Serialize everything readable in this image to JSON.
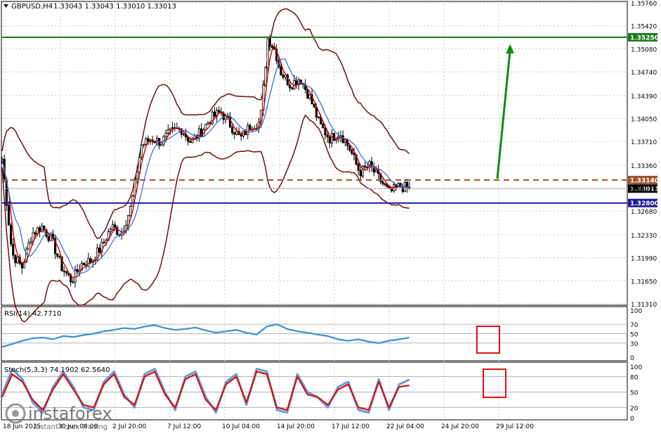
{
  "main_header": {
    "symbol_tf": "GBPUSD,H4",
    "ohlc": "1.33043 1.33043 1.33010 1.33013"
  },
  "rsi_header": "RSI(14) 42.7710",
  "stoch_header": "Stoch(5,3,3) 74.1902 62.5640",
  "logo": {
    "name": "instaforex",
    "tagline": "Instant Forex Trading"
  },
  "colors": {
    "background": "#ffffff",
    "grid": "#c8c8c8",
    "candle": "#000000",
    "bollinger": "#6b0f0f",
    "ma_fast": "#d00000",
    "ma_slow": "#3b6fcf",
    "resistance": "#1a7a1a",
    "support": "#1a1a9a",
    "dashed_level": "#a0522d",
    "arrow": "#138a13",
    "rsi_line": "#3a8fd6",
    "stoch_main": "#6b9ad6",
    "stoch_signal": "#d01010",
    "highlight_box": "#e01010",
    "price_tag_green": "#1a7a1a",
    "price_tag_blue": "#1a1a9a",
    "price_tag_brown": "#a0522d",
    "price_tag_current": "#000000"
  },
  "chart_data": [
    {
      "type": "candlestick",
      "title": "GBPUSD,H4",
      "y_tick_labels": [
        "1.35760",
        "1.35420",
        "1.35080",
        "1.34740",
        "1.34390",
        "1.34050",
        "1.33710",
        "1.33360",
        "1.33020",
        "1.32680",
        "1.32330",
        "1.31990",
        "1.31650",
        "1.31310"
      ],
      "x_tick_labels": [
        "18 Jun 2025",
        "30 Jun 04:00",
        "2 Jul 20:00",
        "7 Jul 12:00",
        "10 Jul 04:00",
        "14 Jul 20:00",
        "17 Jul 12:00",
        "22 Jul 04:00",
        "24 Jul 20:00",
        "29 Jul 12:00"
      ],
      "ylim": [
        1.3131,
        1.3576
      ],
      "grid": true,
      "levels": [
        {
          "label": "1.35250",
          "value": 1.3525,
          "role": "resistance"
        },
        {
          "label": "1.33140",
          "value": 1.3314,
          "role": "dashed_level"
        },
        {
          "label": "1.33013",
          "value": 1.33013,
          "role": "current"
        },
        {
          "label": "1.32800",
          "value": 1.328,
          "role": "support"
        }
      ],
      "close_path": [
        {
          "t": 0,
          "v": 1.3345
        },
        {
          "t": 0.02,
          "v": 1.3205
        },
        {
          "t": 0.04,
          "v": 1.3185
        },
        {
          "t": 0.06,
          "v": 1.3235
        },
        {
          "t": 0.08,
          "v": 1.3245
        },
        {
          "t": 0.1,
          "v": 1.3225
        },
        {
          "t": 0.12,
          "v": 1.3185
        },
        {
          "t": 0.14,
          "v": 1.3165
        },
        {
          "t": 0.16,
          "v": 1.319
        },
        {
          "t": 0.18,
          "v": 1.3195
        },
        {
          "t": 0.2,
          "v": 1.3215
        },
        {
          "t": 0.22,
          "v": 1.3245
        },
        {
          "t": 0.24,
          "v": 1.3235
        },
        {
          "t": 0.26,
          "v": 1.3275
        },
        {
          "t": 0.28,
          "v": 1.3365
        },
        {
          "t": 0.3,
          "v": 1.3375
        },
        {
          "t": 0.32,
          "v": 1.337
        },
        {
          "t": 0.34,
          "v": 1.3385
        },
        {
          "t": 0.36,
          "v": 1.339
        },
        {
          "t": 0.38,
          "v": 1.337
        },
        {
          "t": 0.4,
          "v": 1.3385
        },
        {
          "t": 0.42,
          "v": 1.3405
        },
        {
          "t": 0.44,
          "v": 1.3415
        },
        {
          "t": 0.46,
          "v": 1.3395
        },
        {
          "t": 0.48,
          "v": 1.3375
        },
        {
          "t": 0.5,
          "v": 1.3395
        },
        {
          "t": 0.52,
          "v": 1.34
        },
        {
          "t": 0.535,
          "v": 1.3525
        },
        {
          "t": 0.55,
          "v": 1.3505
        },
        {
          "t": 0.56,
          "v": 1.3475
        },
        {
          "t": 0.58,
          "v": 1.3455
        },
        {
          "t": 0.6,
          "v": 1.3465
        },
        {
          "t": 0.62,
          "v": 1.3435
        },
        {
          "t": 0.64,
          "v": 1.3395
        },
        {
          "t": 0.66,
          "v": 1.3375
        },
        {
          "t": 0.68,
          "v": 1.3385
        },
        {
          "t": 0.7,
          "v": 1.336
        },
        {
          "t": 0.72,
          "v": 1.3325
        },
        {
          "t": 0.74,
          "v": 1.3335
        },
        {
          "t": 0.76,
          "v": 1.3315
        },
        {
          "t": 0.78,
          "v": 1.3295
        },
        {
          "t": 0.8,
          "v": 1.3305
        },
        {
          "t": 0.82,
          "v": 1.3301
        }
      ]
    },
    {
      "type": "line",
      "title": "RSI(14)",
      "y_tick_labels": [
        "100",
        "70",
        "50",
        "30",
        "0"
      ],
      "ylim": [
        0,
        100
      ],
      "series": [
        {
          "name": "RSI(14)",
          "values": [
            22,
            28,
            35,
            40,
            42,
            38,
            45,
            43,
            47,
            50,
            55,
            58,
            62,
            60,
            65,
            68,
            62,
            58,
            60,
            63,
            57,
            52,
            55,
            58,
            52,
            48,
            65,
            70,
            60,
            55,
            52,
            48,
            45,
            38,
            35,
            38,
            33,
            30,
            35,
            38,
            42
          ]
        }
      ]
    },
    {
      "type": "line",
      "title": "Stoch(5,3,3)",
      "y_tick_labels": [
        "100",
        "80",
        "50",
        "20",
        "0"
      ],
      "ylim": [
        0,
        100
      ],
      "series": [
        {
          "name": "main",
          "values": [
            45,
            95,
            75,
            30,
            10,
            60,
            90,
            60,
            20,
            15,
            70,
            90,
            45,
            20,
            85,
            95,
            50,
            15,
            80,
            90,
            40,
            10,
            70,
            85,
            25,
            95,
            90,
            15,
            10,
            85,
            50,
            40,
            20,
            60,
            70,
            15,
            10,
            75,
            15,
            65,
            74
          ]
        },
        {
          "name": "signal",
          "values": [
            40,
            85,
            70,
            35,
            15,
            55,
            85,
            55,
            25,
            20,
            65,
            85,
            40,
            25,
            80,
            90,
            45,
            20,
            75,
            85,
            35,
            15,
            65,
            80,
            30,
            90,
            85,
            20,
            15,
            80,
            45,
            40,
            25,
            55,
            65,
            20,
            15,
            70,
            20,
            60,
            63
          ]
        }
      ]
    }
  ]
}
